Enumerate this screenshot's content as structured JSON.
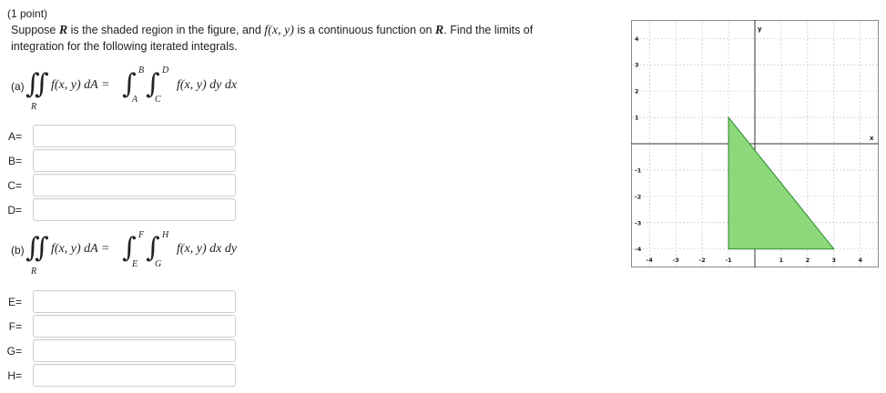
{
  "header": {
    "points": "(1 point)"
  },
  "problem": {
    "line1_pre": "Suppose ",
    "region": "R",
    "line1_mid": " is the shaded region in the figure, and ",
    "func": "f(x, y)",
    "line1_post": " is a continuous function on ",
    "line1_end": ". Find the limits of",
    "line2": "integration for the following iterated integrals."
  },
  "part_a": {
    "label": "(a)",
    "lhs": "f(x, y) dA =",
    "rhs": "f(x, y) dy dx",
    "region_sub": "R",
    "outer_upper": "B",
    "outer_lower": "A",
    "inner_upper": "D",
    "inner_lower": "C",
    "fields": [
      {
        "label": "A=",
        "value": ""
      },
      {
        "label": "B=",
        "value": ""
      },
      {
        "label": "C=",
        "value": ""
      },
      {
        "label": "D=",
        "value": ""
      }
    ]
  },
  "part_b": {
    "label": "(b)",
    "lhs": "f(x, y) dA =",
    "rhs": "f(x, y) dx dy",
    "region_sub": "R",
    "outer_upper": "F",
    "outer_lower": "E",
    "inner_upper": "H",
    "inner_lower": "G",
    "fields": [
      {
        "label": "E=",
        "value": ""
      },
      {
        "label": "F=",
        "value": ""
      },
      {
        "label": "G=",
        "value": ""
      },
      {
        "label": "H=",
        "value": ""
      }
    ]
  },
  "graph": {
    "x_axis_label": "x",
    "y_axis_label": "y",
    "x_ticks": [
      "-4",
      "-3",
      "-2",
      "-1",
      "1",
      "2",
      "3",
      "4"
    ],
    "y_ticks": [
      "4",
      "3",
      "2",
      "1",
      "-1",
      "-2",
      "-3",
      "-4"
    ],
    "xlim": [
      -4.7,
      4.7
    ],
    "ylim": [
      -4.7,
      4.7
    ],
    "region_vertices": [
      [
        -1,
        1
      ],
      [
        -1,
        -4
      ],
      [
        3,
        -4
      ]
    ],
    "fill_color": "#8cd87a",
    "stroke_color": "#2e8b2e"
  }
}
